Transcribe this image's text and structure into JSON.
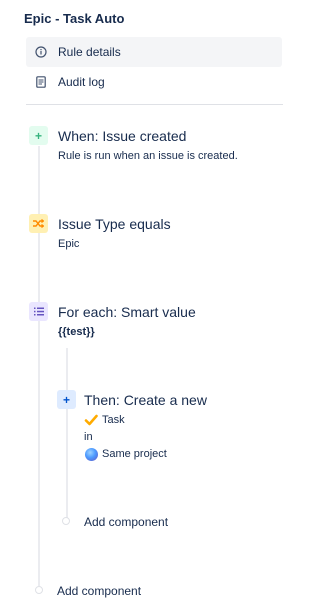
{
  "rule": {
    "title": "Epic - Task Auto"
  },
  "nav": {
    "items": [
      {
        "label": "Rule details",
        "icon": "info-icon",
        "active": true
      },
      {
        "label": "Audit log",
        "icon": "document-icon",
        "active": false
      }
    ]
  },
  "flow": {
    "trigger": {
      "title": "When: Issue created",
      "subtitle": "Rule is run when an issue is created.",
      "icon": "plus-icon",
      "color": "#36b37e"
    },
    "condition": {
      "title": "Issue Type equals",
      "value": "Epic",
      "icon": "shuffle-icon",
      "color": "#ff8b00"
    },
    "branch": {
      "title": "For each: Smart value",
      "value": "{{test}}",
      "icon": "list-icon",
      "color": "#6554c0",
      "action": {
        "title": "Then: Create a new",
        "issue_type": "Task",
        "in_label": "in",
        "project": "Same project",
        "icon": "plus-icon",
        "color": "#0052cc"
      },
      "add_component": "Add component"
    },
    "add_component": "Add component"
  }
}
